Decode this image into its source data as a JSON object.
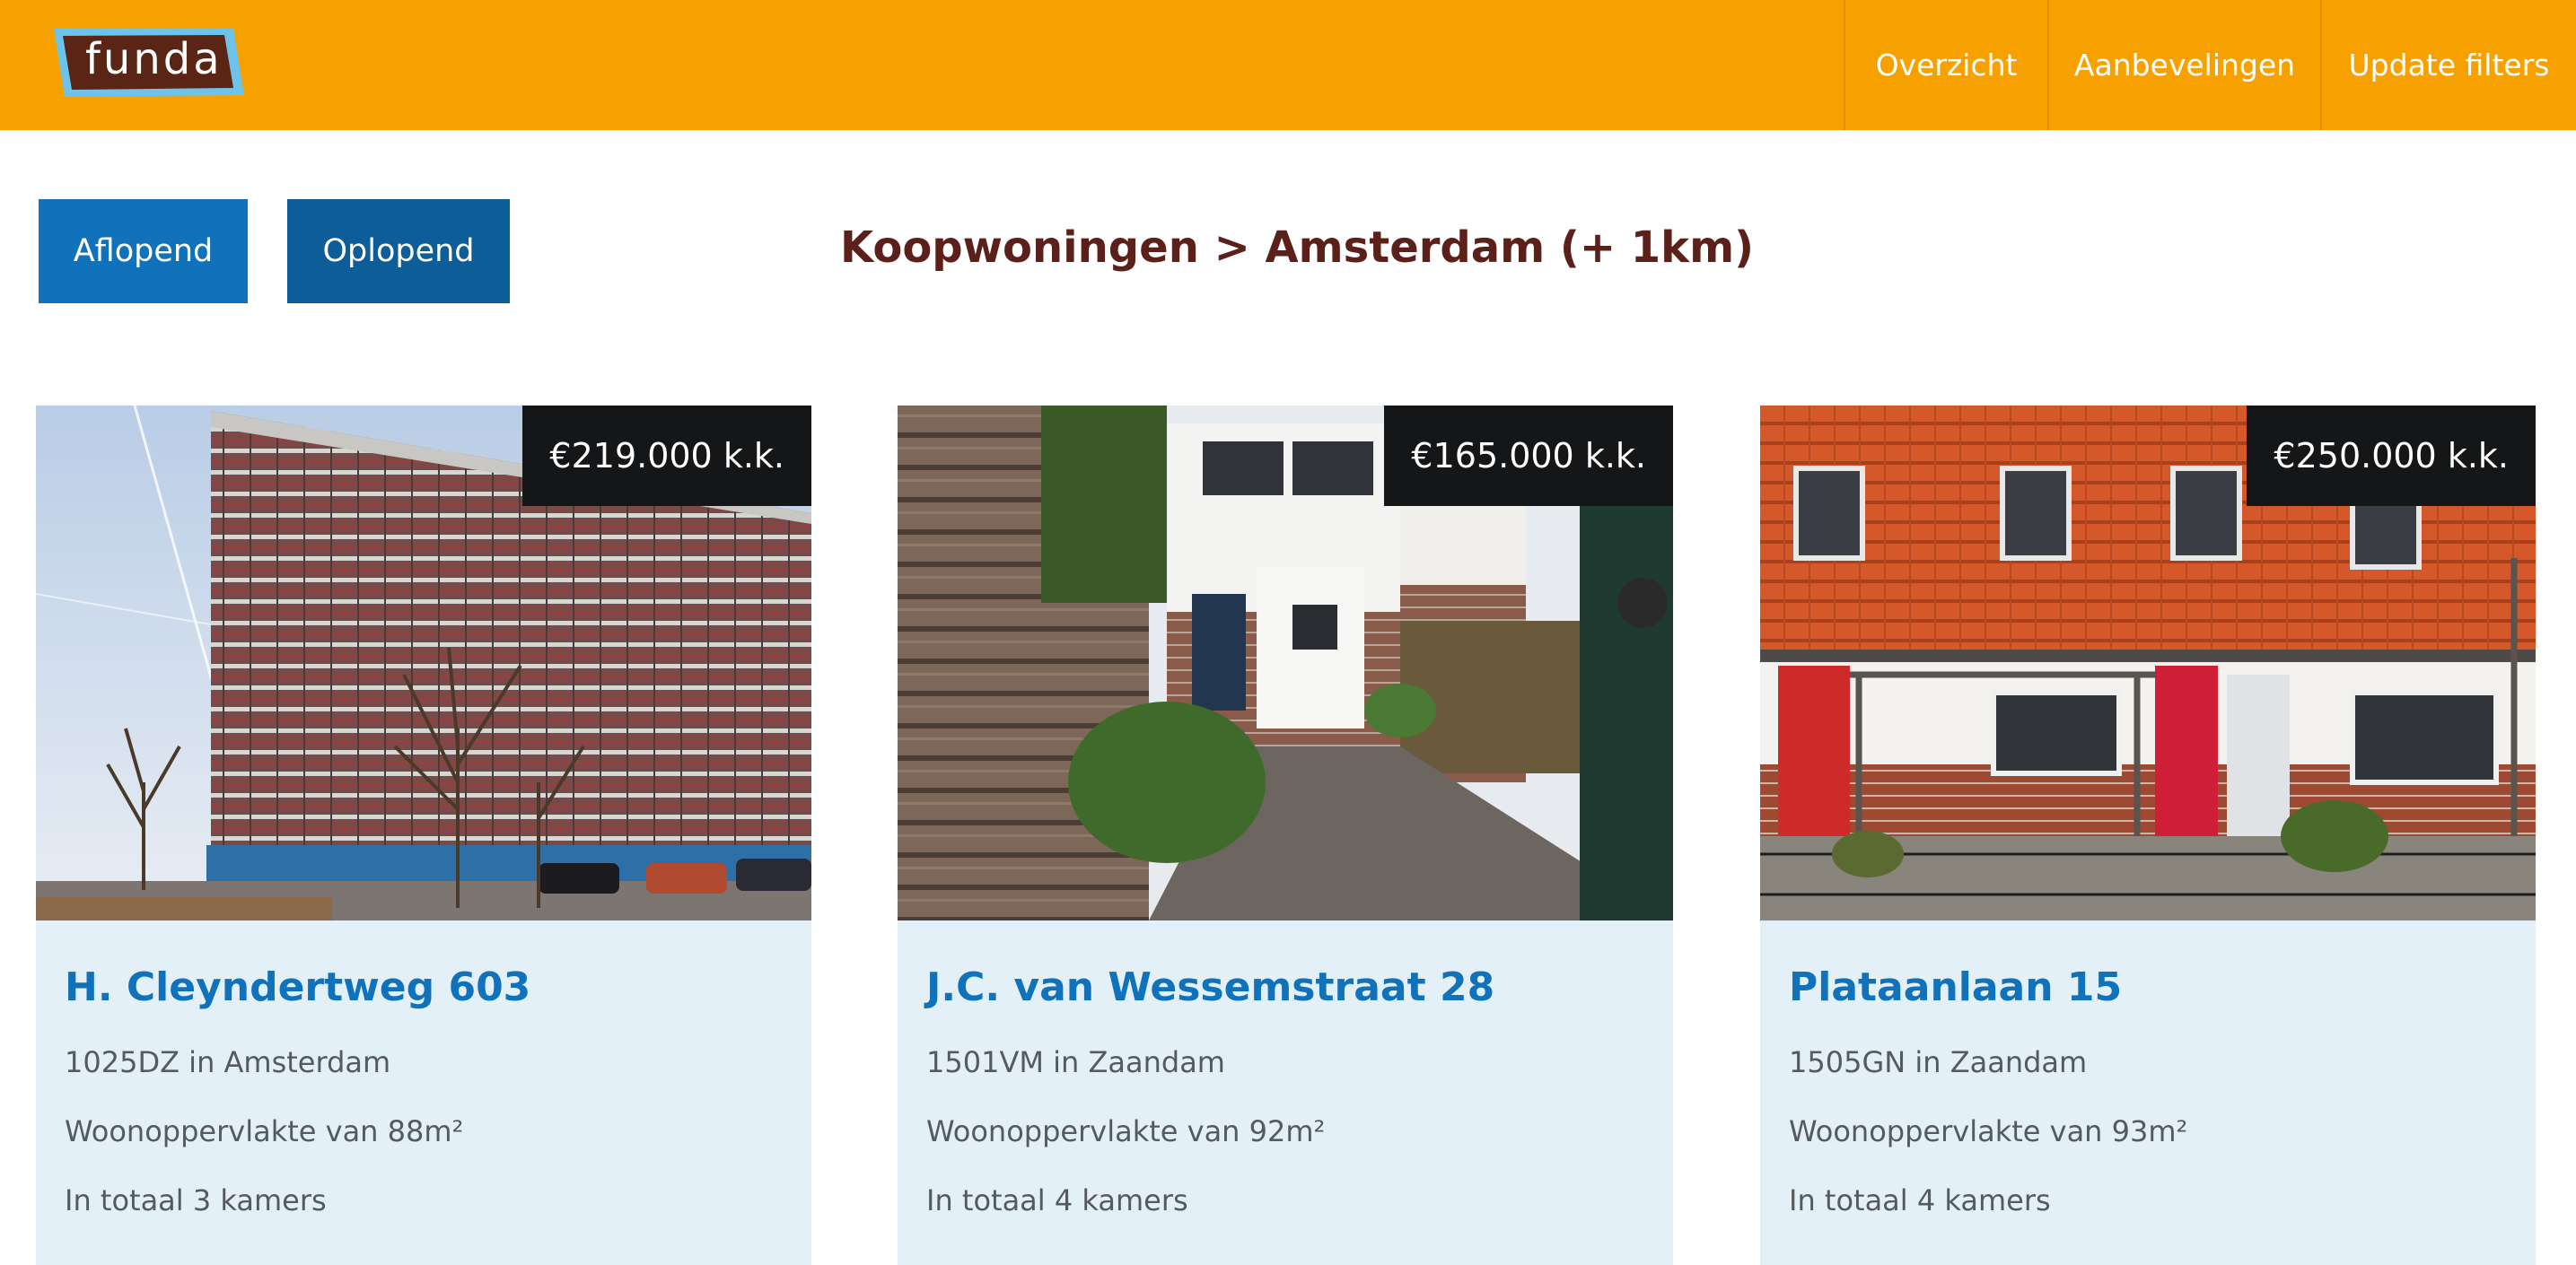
{
  "header": {
    "logo_text": "funda",
    "nav": [
      {
        "label": "Overzicht"
      },
      {
        "label": "Aanbevelingen"
      },
      {
        "label": "Update filters"
      }
    ]
  },
  "sort": {
    "descending_label": "Aflopend",
    "ascending_label": "Oplopend"
  },
  "page_title": "Koopwoningen > Amsterdam (+ 1km)",
  "listings": [
    {
      "price": "€219.000 k.k.",
      "street": "H. Cleyndertweg 603",
      "location": "1025DZ in Amsterdam",
      "area": "Woonoppervlakte van 88m²",
      "rooms": "In totaal 3 kamers"
    },
    {
      "price": "€165.000 k.k.",
      "street": "J.C. van Wessemstraat 28",
      "location": "1501VM in Zaandam",
      "area": "Woonoppervlakte van 92m²",
      "rooms": "In totaal 4 kamers"
    },
    {
      "price": "€250.000 k.k.",
      "street": "Plataanlaan 15",
      "location": "1505GN in Zaandam",
      "area": "Woonoppervlakte van 93m²",
      "rooms": "In totaal 4 kamers"
    }
  ],
  "colors": {
    "header_orange": "#f7a100",
    "button_blue": "#0f72bb",
    "button_blue_dark": "#0c5d98",
    "title_brown": "#5a2019",
    "card_bg": "#e4f0f8",
    "price_bg": "#141618"
  }
}
